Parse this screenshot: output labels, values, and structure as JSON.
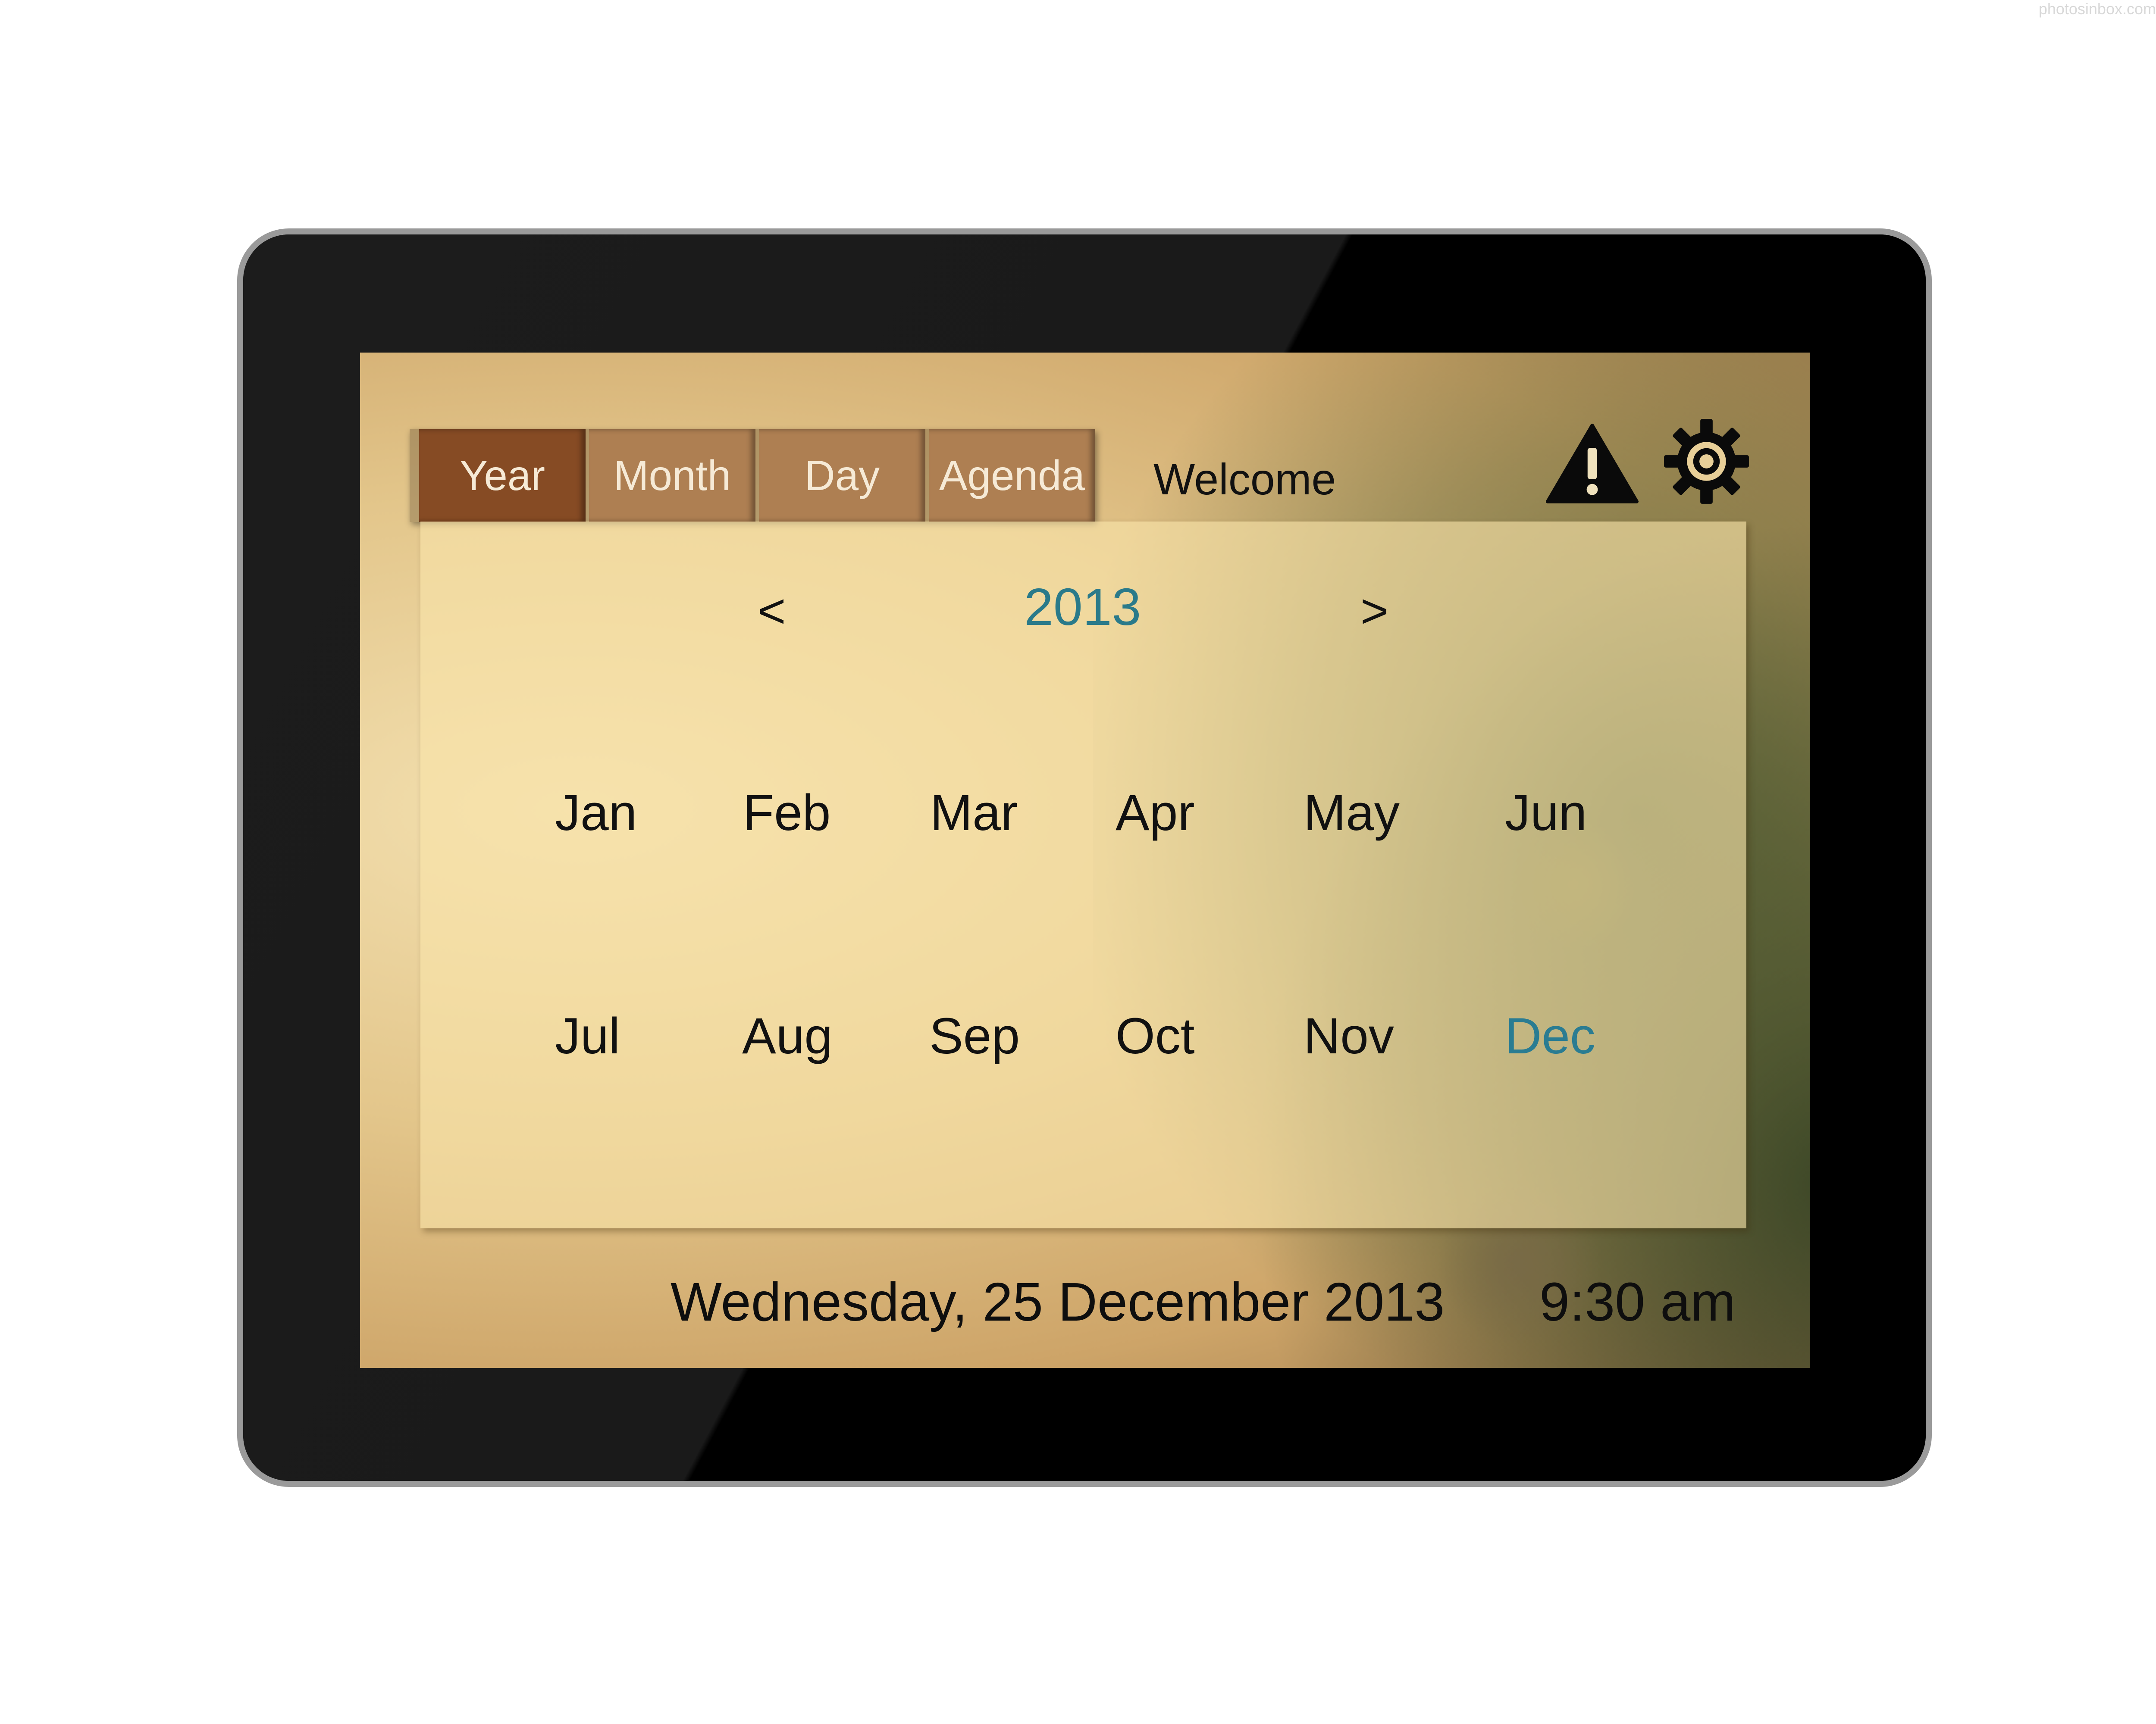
{
  "watermark": "photosinbox.com",
  "tabs": {
    "year": "Year",
    "month": "Month",
    "day": "Day",
    "agenda": "Agenda",
    "active": "Year"
  },
  "header": {
    "welcome": "Welcome",
    "alert_icon": "warning-icon",
    "settings_icon": "gear-icon"
  },
  "calendar": {
    "prev": "<",
    "next": ">",
    "year": "2013",
    "months": [
      "Jan",
      "Feb",
      "Mar",
      "Apr",
      "May",
      "Jun",
      "Jul",
      "Aug",
      "Sep",
      "Oct",
      "Nov",
      "Dec"
    ],
    "selected_month": "Dec"
  },
  "footer": {
    "date": "Wednesday, 25 December 2013",
    "time": "9:30 am"
  },
  "colors": {
    "accent": "#2a7c92",
    "tab_active": "#864b24",
    "tab_inactive": "#ae7f52",
    "bezel": "#121212"
  }
}
